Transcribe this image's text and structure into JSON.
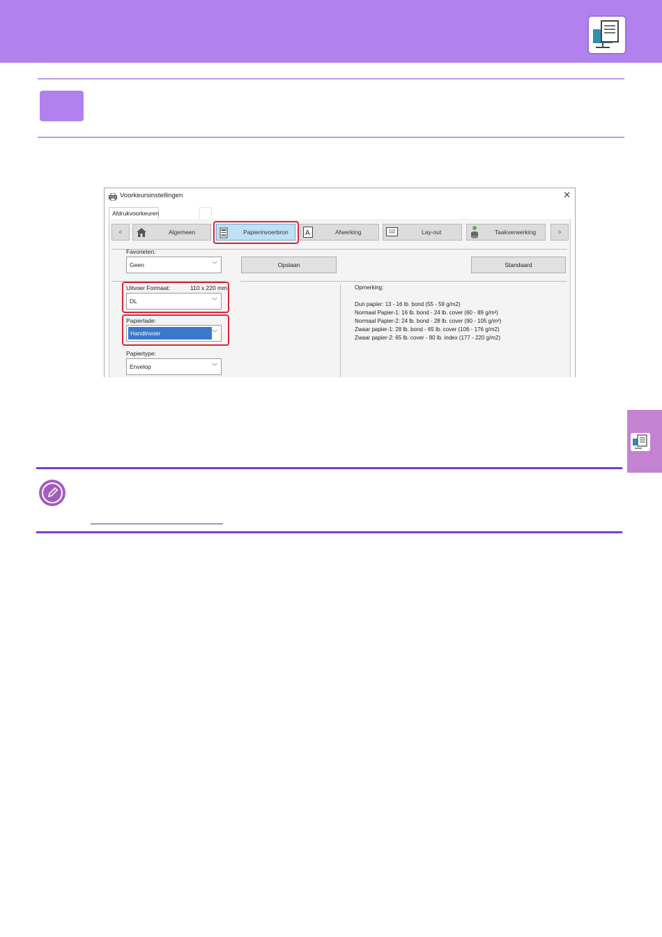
{
  "dialog": {
    "title": "Voorkeursinstellingen",
    "close": "✕",
    "tab": "Afdrukvoorkeuren",
    "nav": {
      "prev": "<",
      "next": ">",
      "items": [
        {
          "label": "Algemeen",
          "icon": "home-icon"
        },
        {
          "label": "Papierinvoerbron",
          "icon": "paper-tray-icon",
          "active": true
        },
        {
          "label": "Afwerking",
          "icon": "finishing-icon"
        },
        {
          "label": "Lay-out",
          "icon": "layout-icon",
          "icon_text": "1|2"
        },
        {
          "label": "Taakverwerking",
          "icon": "job-handling-icon"
        }
      ]
    },
    "favorieten": {
      "label": "Favorieten:",
      "value": "Geen"
    },
    "opslaan": "Opslaan",
    "standaard": "Standaard",
    "uitvoer_formaat": {
      "label": "Uitvoer Formaat:",
      "size": "110 x 220 mm",
      "value": "DL"
    },
    "papierlade": {
      "label": "Papierlade:",
      "value": "Handinvoer"
    },
    "papiertype": {
      "label": "Papiertype:",
      "value": "Envelop"
    },
    "opmerking": {
      "title": "Opmerking:",
      "lines": [
        "Dun papier: 13 - 16 lb. bond (55 - 59 g/m2)",
        "Normaal Papier-1: 16 lb. bond - 24 lb. cover (60 - 89 g/m²)",
        "Normaal Papier-2: 24 lb. bond - 28 lb. cover (90 - 105 g/m²)",
        "Zwaar papier-1: 28 lb. bond - 65 lb. cover (106 - 176 g/m2)",
        "Zwaar papier-2: 65 lb. cover - 80 lb. index (177 - 220 g/m2)"
      ]
    }
  },
  "colors": {
    "accent": "#b182ee",
    "highlight": "#d6263b",
    "side_tab": "#c482d2"
  }
}
